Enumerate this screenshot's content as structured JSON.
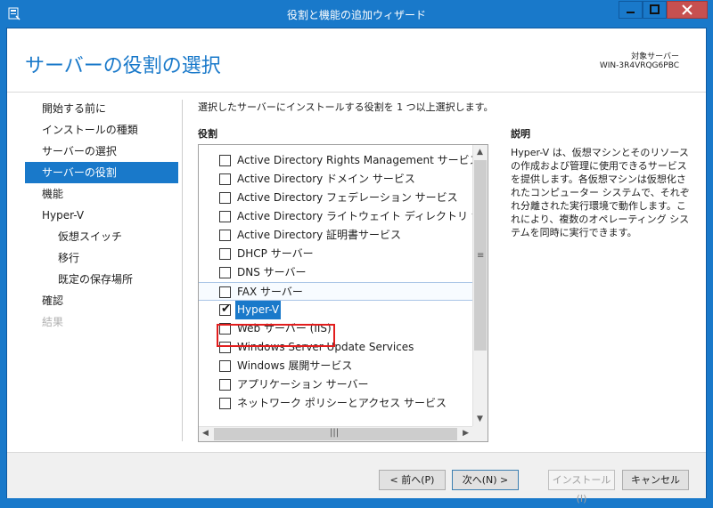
{
  "window": {
    "title": "役割と機能の追加ウィザード",
    "controls": {
      "minimize": "—",
      "maximize": "☐",
      "close": "✕"
    }
  },
  "header": {
    "page_title": "サーバーの役割の選択",
    "target_label": "対象サーバー",
    "target_value": "WIN-3R4VRQG6PBC"
  },
  "nav": [
    {
      "label": "開始する前に",
      "state": "normal",
      "indent": 0
    },
    {
      "label": "インストールの種類",
      "state": "normal",
      "indent": 0
    },
    {
      "label": "サーバーの選択",
      "state": "normal",
      "indent": 0
    },
    {
      "label": "サーバーの役割",
      "state": "selected",
      "indent": 0
    },
    {
      "label": "機能",
      "state": "normal",
      "indent": 0
    },
    {
      "label": "Hyper-V",
      "state": "normal",
      "indent": 0
    },
    {
      "label": "仮想スイッチ",
      "state": "normal",
      "indent": 1
    },
    {
      "label": "移行",
      "state": "normal",
      "indent": 1
    },
    {
      "label": "既定の保存場所",
      "state": "normal",
      "indent": 1
    },
    {
      "label": "確認",
      "state": "normal",
      "indent": 0
    },
    {
      "label": "結果",
      "state": "disabled",
      "indent": 0
    }
  ],
  "main": {
    "intro": "選択したサーバーにインストールする役割を 1 つ以上選択します。",
    "roles_heading": "役割",
    "roles": [
      {
        "label": "Active Directory Rights Management サービス",
        "checked": false
      },
      {
        "label": "Active Directory ドメイン サービス",
        "checked": false
      },
      {
        "label": "Active Directory フェデレーション サービス",
        "checked": false
      },
      {
        "label": "Active Directory ライトウェイト ディレクトリ サービス",
        "checked": false
      },
      {
        "label": "Active Directory 証明書サービス",
        "checked": false
      },
      {
        "label": "DHCP サーバー",
        "checked": false
      },
      {
        "label": "DNS サーバー",
        "checked": false
      },
      {
        "label": "FAX サーバー",
        "checked": false,
        "hover": true
      },
      {
        "label": "Hyper-V",
        "checked": true,
        "selected": true
      },
      {
        "label": "Web サーバー (IIS)",
        "checked": false
      },
      {
        "label": "Windows Server Update Services",
        "checked": false
      },
      {
        "label": "Windows 展開サービス",
        "checked": false
      },
      {
        "label": "アプリケーション サーバー",
        "checked": false
      },
      {
        "label": "ネットワーク ポリシーとアクセス サービス",
        "checked": false
      }
    ],
    "description_heading": "説明",
    "description": "Hyper-V は、仮想マシンとそのリソースの作成および管理に使用できるサービスを提供します。各仮想マシンは仮想化されたコンピューター システムで、それぞれ分離された実行環境で動作します。これにより、複数のオペレーティング システムを同時に実行できます。"
  },
  "footer": {
    "prev": "< 前へ(P)",
    "next": "次へ(N) >",
    "install": "インストール(I)",
    "cancel": "キャンセル"
  },
  "colors": {
    "accent": "#1979ca",
    "highlight_box": "#e21d1d"
  }
}
